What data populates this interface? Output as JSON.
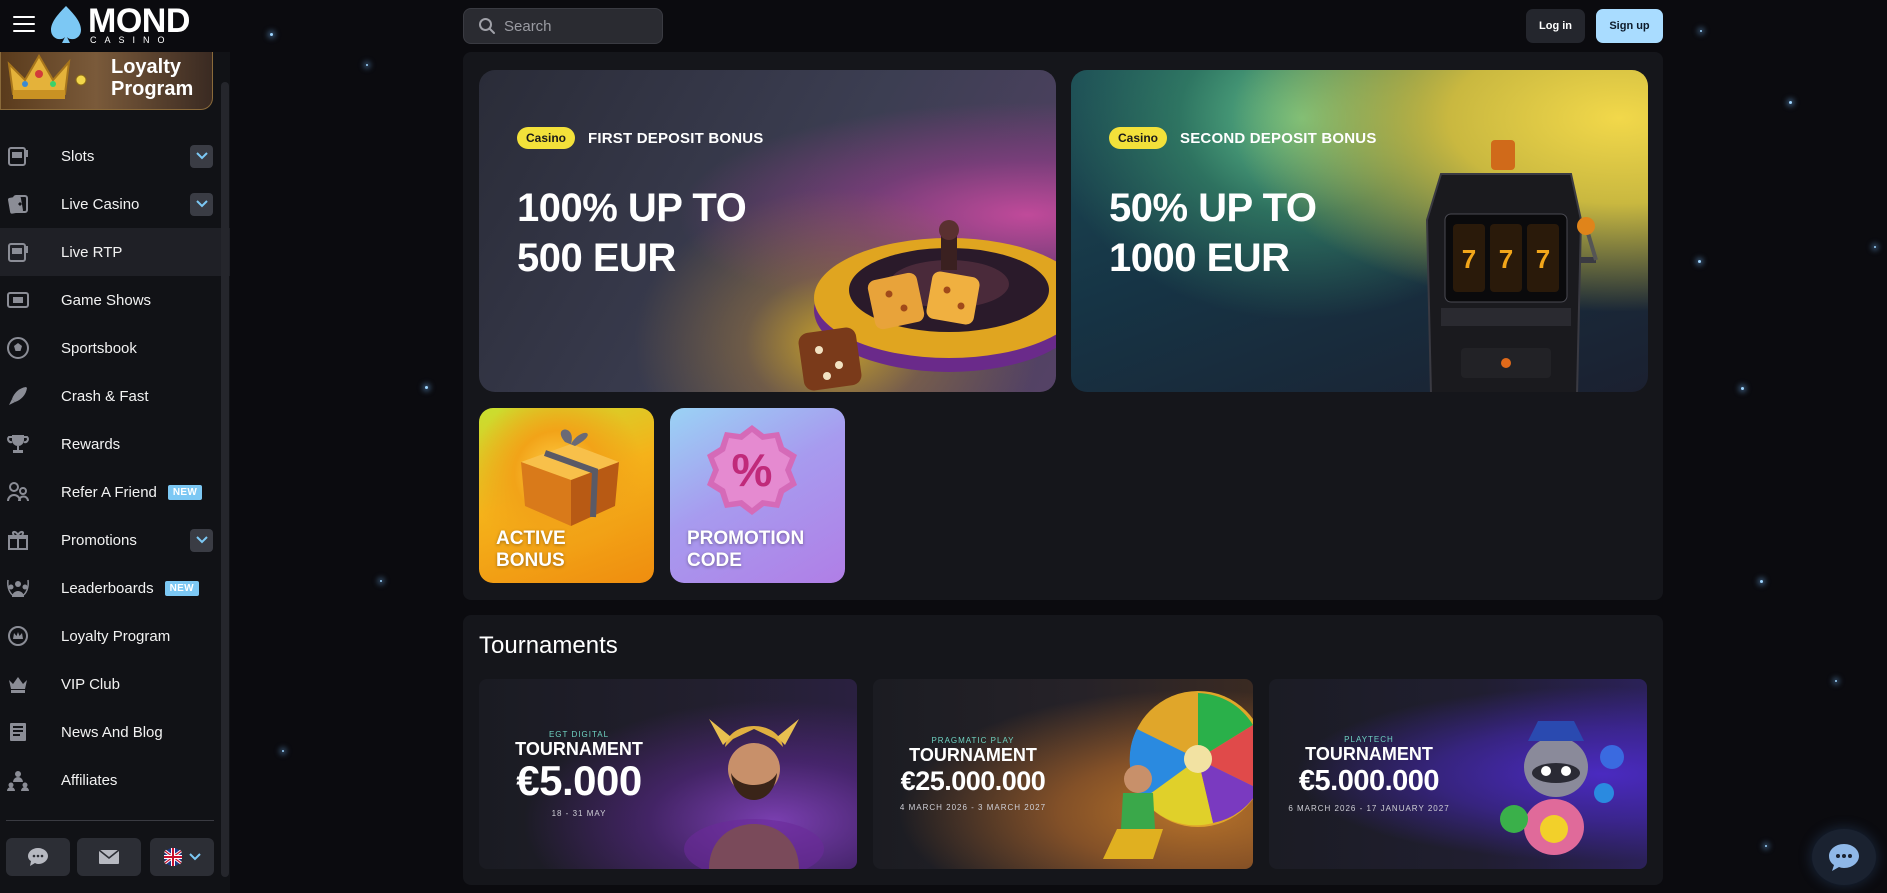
{
  "header": {
    "logo_main": "MOND",
    "logo_sub": "CASINO",
    "search_placeholder": "Search",
    "login_label": "Log in",
    "signup_label": "Sign up"
  },
  "sidebar": {
    "loyalty_banner": "Loyalty Program",
    "items": [
      {
        "label": "Slots",
        "icon": "slot-machine-icon",
        "has_chevron": true
      },
      {
        "label": "Live Casino",
        "icon": "cards-icon",
        "has_chevron": true
      },
      {
        "label": "Live RTP",
        "icon": "slot-machine-icon",
        "active": true
      },
      {
        "label": "Game Shows",
        "icon": "tv-icon"
      },
      {
        "label": "Sportsbook",
        "icon": "soccer-ball-icon"
      },
      {
        "label": "Crash & Fast",
        "icon": "rocket-icon"
      },
      {
        "label": "Rewards",
        "icon": "trophy-icon"
      },
      {
        "label": "Refer A Friend",
        "icon": "users-icon",
        "badge": "NEW"
      },
      {
        "label": "Promotions",
        "icon": "gift-icon",
        "has_chevron": true
      },
      {
        "label": "Leaderboards",
        "icon": "leaderboard-icon",
        "badge": "NEW"
      },
      {
        "label": "Loyalty Program",
        "icon": "crown-badge-icon"
      },
      {
        "label": "VIP Club",
        "icon": "vip-crown-icon"
      },
      {
        "label": "News And Blog",
        "icon": "newspaper-icon"
      },
      {
        "label": "Affiliates",
        "icon": "affiliates-icon"
      }
    ],
    "footer_buttons": [
      "chat-icon",
      "mail-icon",
      "uk-flag-icon"
    ]
  },
  "promos": [
    {
      "tag": "Casino",
      "title": "FIRST DEPOSIT BONUS",
      "line1": "100% UP TO",
      "line2": "500 EUR"
    },
    {
      "tag": "Casino",
      "title": "SECOND DEPOSIT BONUS",
      "line1": "50% UP TO",
      "line2": "1000 EUR"
    }
  ],
  "small_cards": [
    {
      "line1": "ACTIVE",
      "line2": "BONUS"
    },
    {
      "line1": "PROMOTION",
      "line2": "CODE"
    }
  ],
  "tournaments": {
    "title": "Tournaments",
    "cards": [
      {
        "provider": "EGT DIGITAL",
        "word": "TOURNAMENT",
        "prize": "€5.000",
        "dates": "18 - 31 MAY"
      },
      {
        "provider": "PRAGMATIC PLAY",
        "word": "TOURNAMENT",
        "prize": "€25.000.000",
        "dates": "4 MARCH 2026 - 3 MARCH 2027"
      },
      {
        "provider": "PLAYTECH",
        "word": "TOURNAMENT",
        "prize": "€5.000.000",
        "dates": "6 MARCH 2026 - 17 JANUARY 2027"
      }
    ]
  },
  "colors": {
    "background": "#0b0b0f",
    "sidebar": "#111216",
    "signup": "#a9dcff",
    "tag_yellow": "#f3e13a",
    "badge_new": "#7cc8f4"
  }
}
